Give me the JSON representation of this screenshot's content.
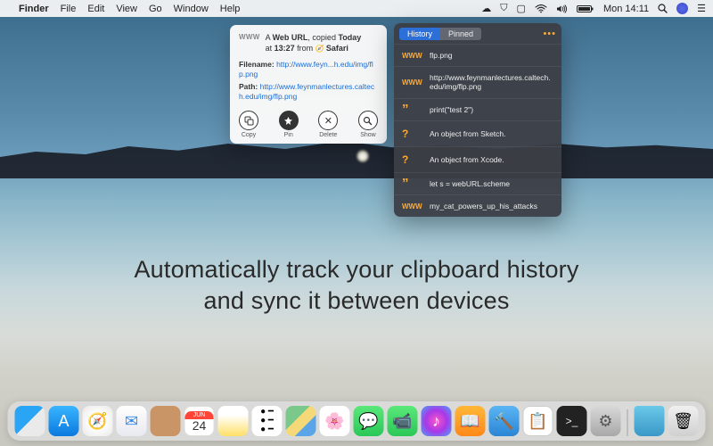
{
  "menubar": {
    "app": "Finder",
    "items": [
      "File",
      "Edit",
      "View",
      "Go",
      "Window",
      "Help"
    ],
    "clock": "Mon 14:11"
  },
  "detail": {
    "badge": "WWW",
    "line1_a": "A ",
    "line1_b": "Web URL",
    "line1_c": ", copied ",
    "line1_d": "Today",
    "line2_a": "at ",
    "line2_b": "13:27",
    "line2_c": " from ",
    "line2_app": "Safari",
    "filename_label": "Filename:",
    "filename_value": "http://www.feyn...h.edu/img/flp.png",
    "path_label": "Path:",
    "path_value": "http://www.feynmanlectures.caltech.edu/img/flp.png",
    "actions": {
      "copy": "Copy",
      "pin": "Pin",
      "delete": "Delete",
      "show": "Show"
    }
  },
  "history": {
    "tabs": {
      "history": "History",
      "pinned": "Pinned"
    },
    "more": "•••",
    "items": [
      {
        "badge": "WWW",
        "text": "flp.png"
      },
      {
        "badge": "WWW",
        "text": "http://www.feynmanlectures.caltech.edu/img/flp.png"
      },
      {
        "badge": "quote",
        "text": "print(\"test 2\")"
      },
      {
        "badge": "?",
        "text": "An object from Sketch."
      },
      {
        "badge": "?",
        "text": "An object from Xcode."
      },
      {
        "badge": "quote",
        "text": "let s = webURL.scheme"
      },
      {
        "badge": "WWW",
        "text": "my_cat_powers_up_his_attacks"
      }
    ]
  },
  "tagline": {
    "line1": "Automatically track your clipboard history",
    "line2": "and sync it between devices"
  },
  "dock": {
    "calendar_month": "JUN",
    "calendar_day": "24"
  }
}
